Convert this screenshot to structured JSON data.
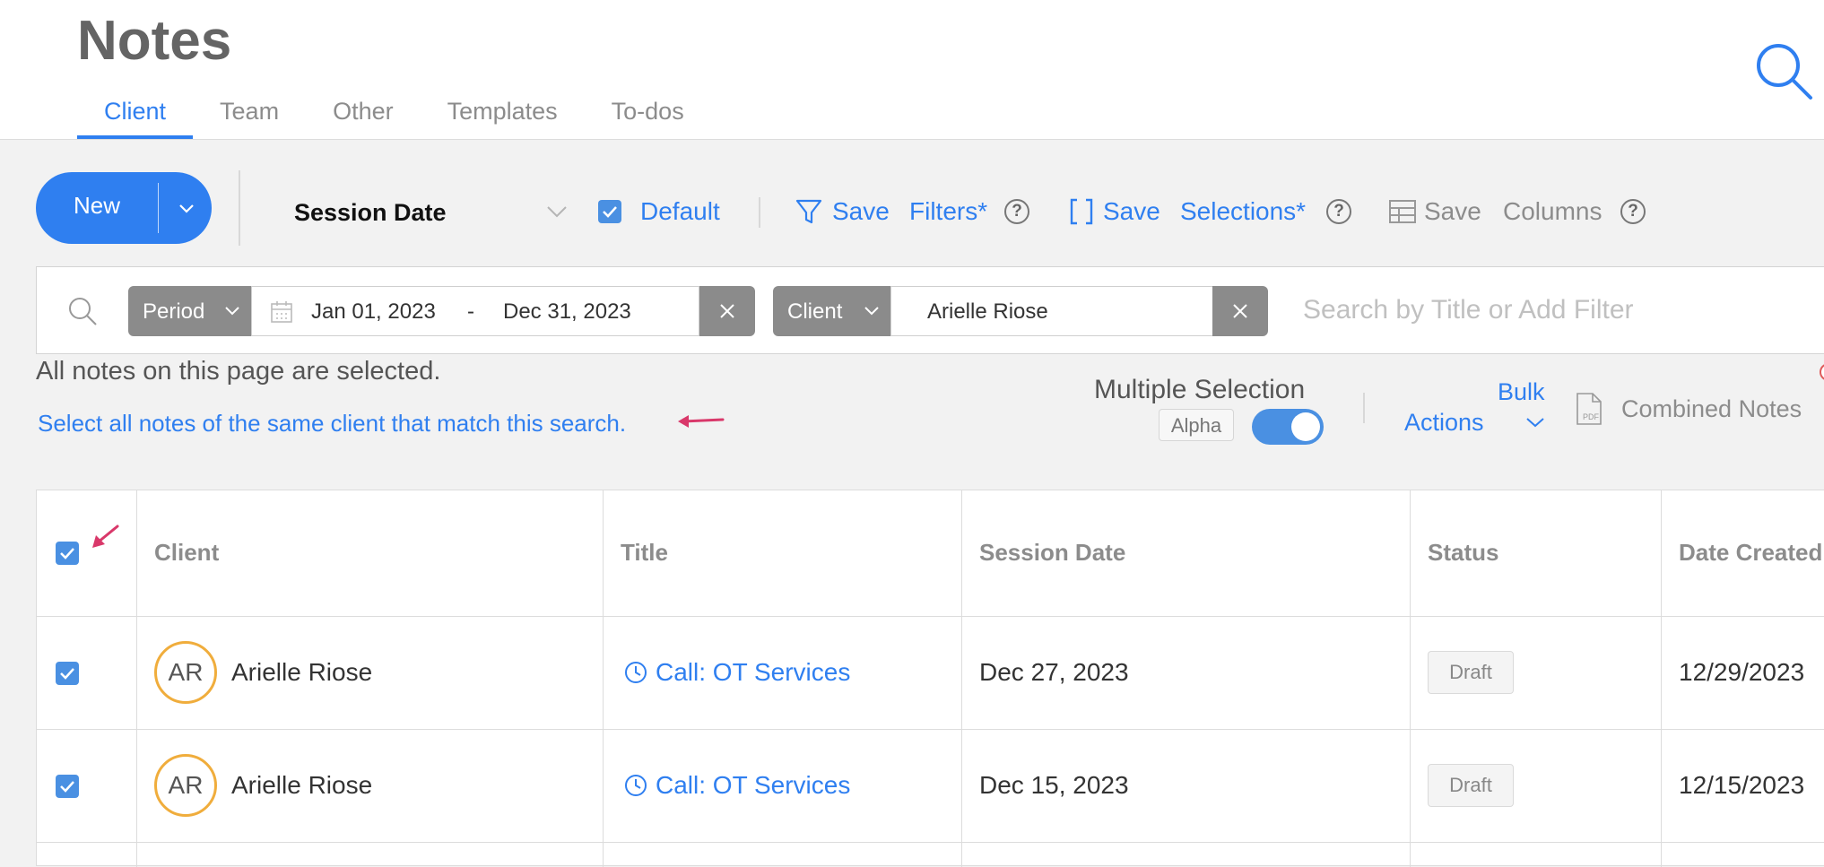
{
  "header": {
    "title": "Notes",
    "tabs": [
      {
        "label": "Client",
        "active": true
      },
      {
        "label": "Team",
        "active": false
      },
      {
        "label": "Other",
        "active": false
      },
      {
        "label": "Templates",
        "active": false
      },
      {
        "label": "To-dos",
        "active": false
      }
    ]
  },
  "toolbar": {
    "new_label": "New",
    "sort_label": "Session Date",
    "default_checked": true,
    "default_label": "Default",
    "save_filters_save": "Save",
    "save_filters_label": "Filters*",
    "save_selections_save": "Save",
    "save_selections_label": "Selections*",
    "save_columns_save": "Save",
    "save_columns_label": "Columns",
    "help_glyph": "?"
  },
  "filters": {
    "period_chip": "Period",
    "date_from": "Jan 01, 2023",
    "date_separator": "-",
    "date_to": "Dec 31, 2023",
    "client_chip": "Client",
    "client_value": "Arielle Riose",
    "search_placeholder": "Search by Title or Add Filter"
  },
  "selection": {
    "message": "All notes on this page are selected.",
    "select_all_link": "Select all notes of the same client that match this search.",
    "multiple_selection_label": "Multiple Selection",
    "alpha_badge": "Alpha",
    "multiple_selection_on": true,
    "bulk_line1": "Bulk",
    "bulk_line2": "Actions",
    "combined_notes_label": "Combined Notes"
  },
  "table": {
    "columns": [
      "Client",
      "Title",
      "Session Date",
      "Status",
      "Date Created"
    ],
    "header_checkbox_checked": true,
    "rows": [
      {
        "checked": true,
        "initials": "AR",
        "client": "Arielle Riose",
        "title": "Call: OT Services",
        "session_date": "Dec 27, 2023",
        "status": "Draft",
        "date_created": "12/29/2023"
      },
      {
        "checked": true,
        "initials": "AR",
        "client": "Arielle Riose",
        "title": "Call: OT Services",
        "session_date": "Dec 15, 2023",
        "status": "Draft",
        "date_created": "12/15/2023"
      }
    ]
  },
  "colors": {
    "accent": "#2f7ff0",
    "checkbox": "#4a90e2",
    "avatar_ring": "#f0ad3c",
    "annotation_arrow": "#d9386a",
    "chip_gray": "#8b8b8b"
  },
  "icons": [
    "search-icon",
    "chevron-down-icon",
    "funnel-icon",
    "brackets-icon",
    "table-icon",
    "help-icon",
    "calendar-icon",
    "close-icon",
    "pdf-file-icon",
    "clock-icon",
    "arrow-annotation-icon",
    "check-icon"
  ]
}
